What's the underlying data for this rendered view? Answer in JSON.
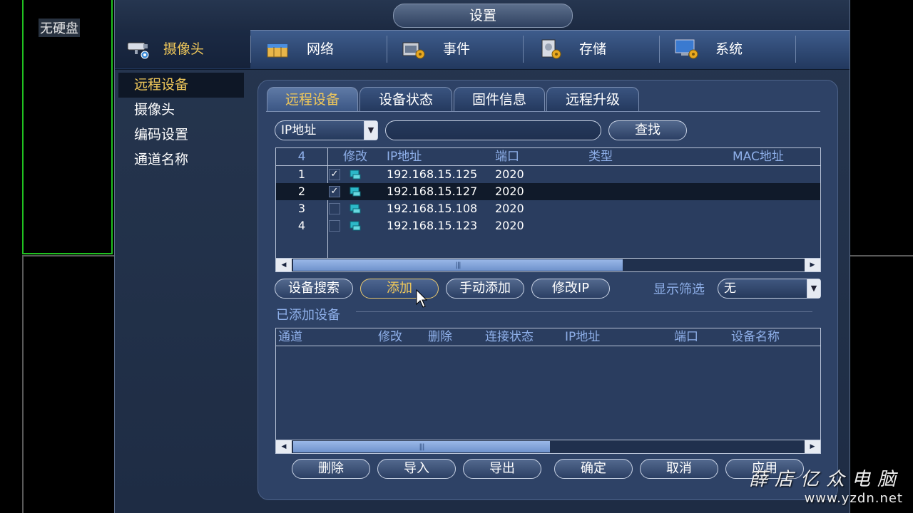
{
  "background": {
    "channel_label": "无硬盘"
  },
  "window": {
    "title": "设置"
  },
  "topnav": {
    "items": [
      {
        "label": "摄像头",
        "icon": "camera-icon",
        "selected": true
      },
      {
        "label": "网络",
        "icon": "network-icon"
      },
      {
        "label": "事件",
        "icon": "event-icon"
      },
      {
        "label": "存储",
        "icon": "storage-icon"
      },
      {
        "label": "系统",
        "icon": "system-icon"
      }
    ]
  },
  "leftmenu": {
    "items": [
      {
        "label": "远程设备",
        "selected": true
      },
      {
        "label": "摄像头"
      },
      {
        "label": "编码设置"
      },
      {
        "label": "通道名称"
      }
    ]
  },
  "tabs": [
    {
      "label": "远程设备",
      "selected": true
    },
    {
      "label": "设备状态"
    },
    {
      "label": "固件信息"
    },
    {
      "label": "远程升级"
    }
  ],
  "search": {
    "type_value": "IP地址",
    "query_value": "",
    "button": "查找"
  },
  "device_table": {
    "count": "4",
    "columns": [
      "修改",
      "IP地址",
      "端口",
      "类型",
      "MAC地址"
    ],
    "rows": [
      {
        "no": "1",
        "checked": true,
        "ip": "192.168.15.125",
        "port": "2020"
      },
      {
        "no": "2",
        "checked": true,
        "ip": "192.168.15.127",
        "port": "2020",
        "selected": true
      },
      {
        "no": "3",
        "checked": false,
        "ip": "192.168.15.108",
        "port": "2020"
      },
      {
        "no": "4",
        "checked": false,
        "ip": "192.168.15.123",
        "port": "2020"
      }
    ]
  },
  "actions": {
    "device_search": "设备搜索",
    "add": "添加",
    "manual_add": "手动添加",
    "modify_ip": "修改IP",
    "filter_label": "显示筛选",
    "filter_value": "无"
  },
  "added_section": {
    "title": "已添加设备"
  },
  "added_table": {
    "columns": [
      "通道",
      "修改",
      "删除",
      "连接状态",
      "IP地址",
      "端口",
      "设备名称"
    ]
  },
  "bottom_buttons": {
    "delete": "删除",
    "import": "导入",
    "export": "导出",
    "ok": "确定",
    "cancel": "取消",
    "apply": "应用"
  },
  "watermark": {
    "line1": "薛店亿众电脑",
    "line2": "www.yzdn.net"
  },
  "colors": {
    "accent": "#f0c85a",
    "header_text": "#8fb0ea",
    "panel": "#2e4266"
  }
}
